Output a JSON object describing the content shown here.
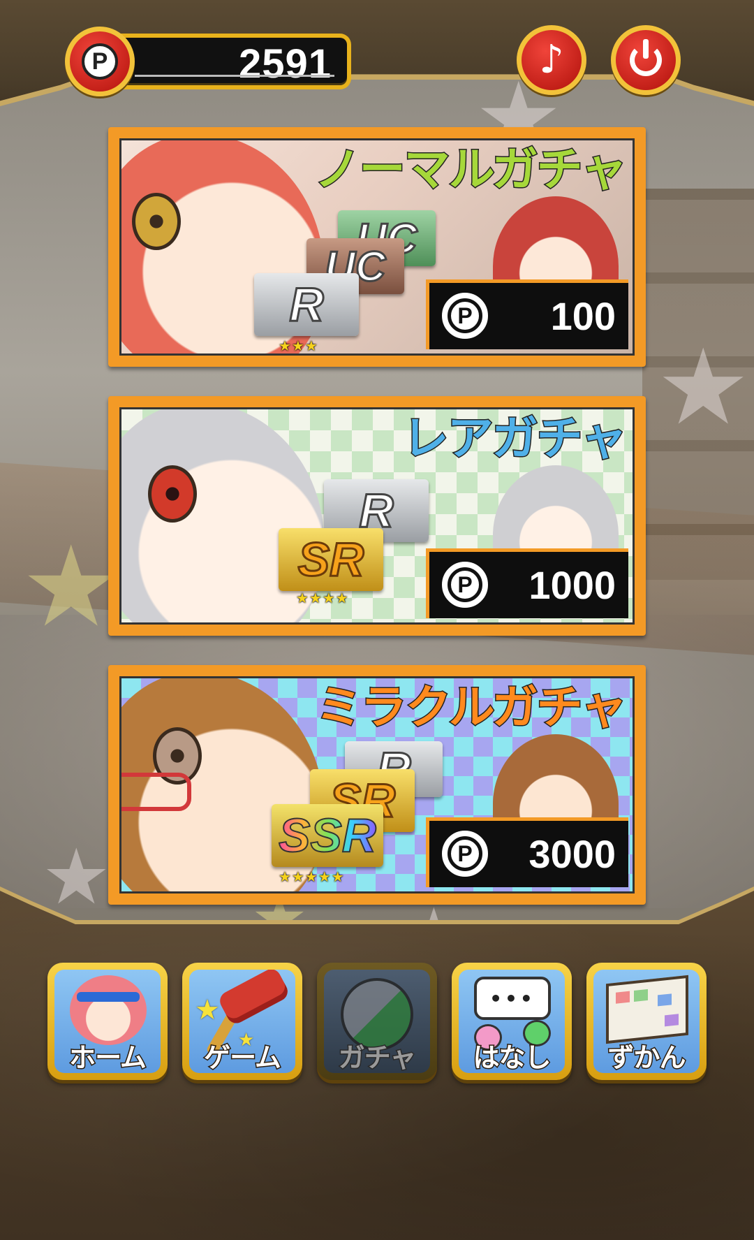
{
  "points": {
    "icon": "p-coin-icon",
    "value": "2591"
  },
  "header_buttons": {
    "music_icon": "♪",
    "power_icon": "power-icon"
  },
  "gacha": [
    {
      "title": "ノーマルガチャ",
      "price": "100",
      "price_icon": "P",
      "rarity_badges": [
        "R"
      ],
      "stars": "★★★"
    },
    {
      "title": "レアガチャ",
      "price": "1000",
      "price_icon": "P",
      "rarity_badges": [
        "R",
        "SR"
      ],
      "stars": "★★★★"
    },
    {
      "title": "ミラクルガチャ",
      "price": "3000",
      "price_icon": "P",
      "rarity_badges": [
        "R",
        "SR",
        "SSR"
      ],
      "stars": "★★★★★"
    }
  ],
  "nav": {
    "items": [
      {
        "label": "ホーム",
        "icon": "home-girl-icon"
      },
      {
        "label": "ゲーム",
        "icon": "hammer-icon"
      },
      {
        "label": "ガチャ",
        "icon": "capsule-icon",
        "active": true
      },
      {
        "label": "はなし",
        "icon": "speech-bubble-icon"
      },
      {
        "label": "ずかん",
        "icon": "book-icon"
      }
    ],
    "bubble_text": "•••"
  },
  "colors": {
    "frame": "#4a3d2a",
    "gold": "#f2c23a",
    "card_border": "#f39a26",
    "accent_red": "#d8251b"
  }
}
